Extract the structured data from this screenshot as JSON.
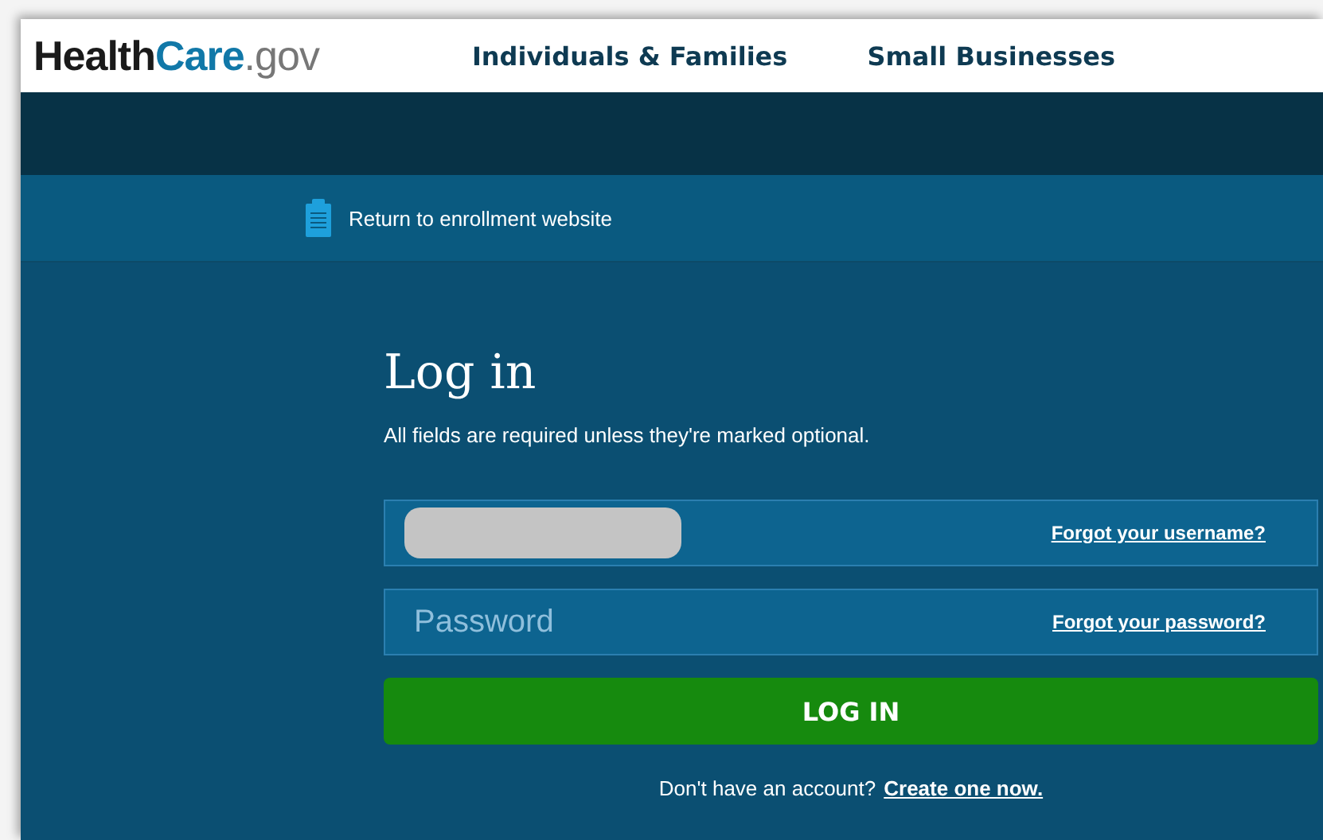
{
  "header": {
    "logo": [
      "Health",
      "Care",
      ".gov"
    ],
    "nav": [
      {
        "label": "Individuals & Families"
      },
      {
        "label": "Small Businesses"
      }
    ]
  },
  "return_link": {
    "label": "Return to enrollment website"
  },
  "login": {
    "title": "Log in",
    "subtitle": "All fields are required unless they're marked optional.",
    "username": {
      "redacted": true,
      "help_link": "Forgot your username?"
    },
    "password": {
      "placeholder": "Password",
      "help_link": "Forgot your password?"
    },
    "button": "LOG IN",
    "signup_prompt": "Don't have an account?",
    "signup_link": "Create one now."
  }
}
